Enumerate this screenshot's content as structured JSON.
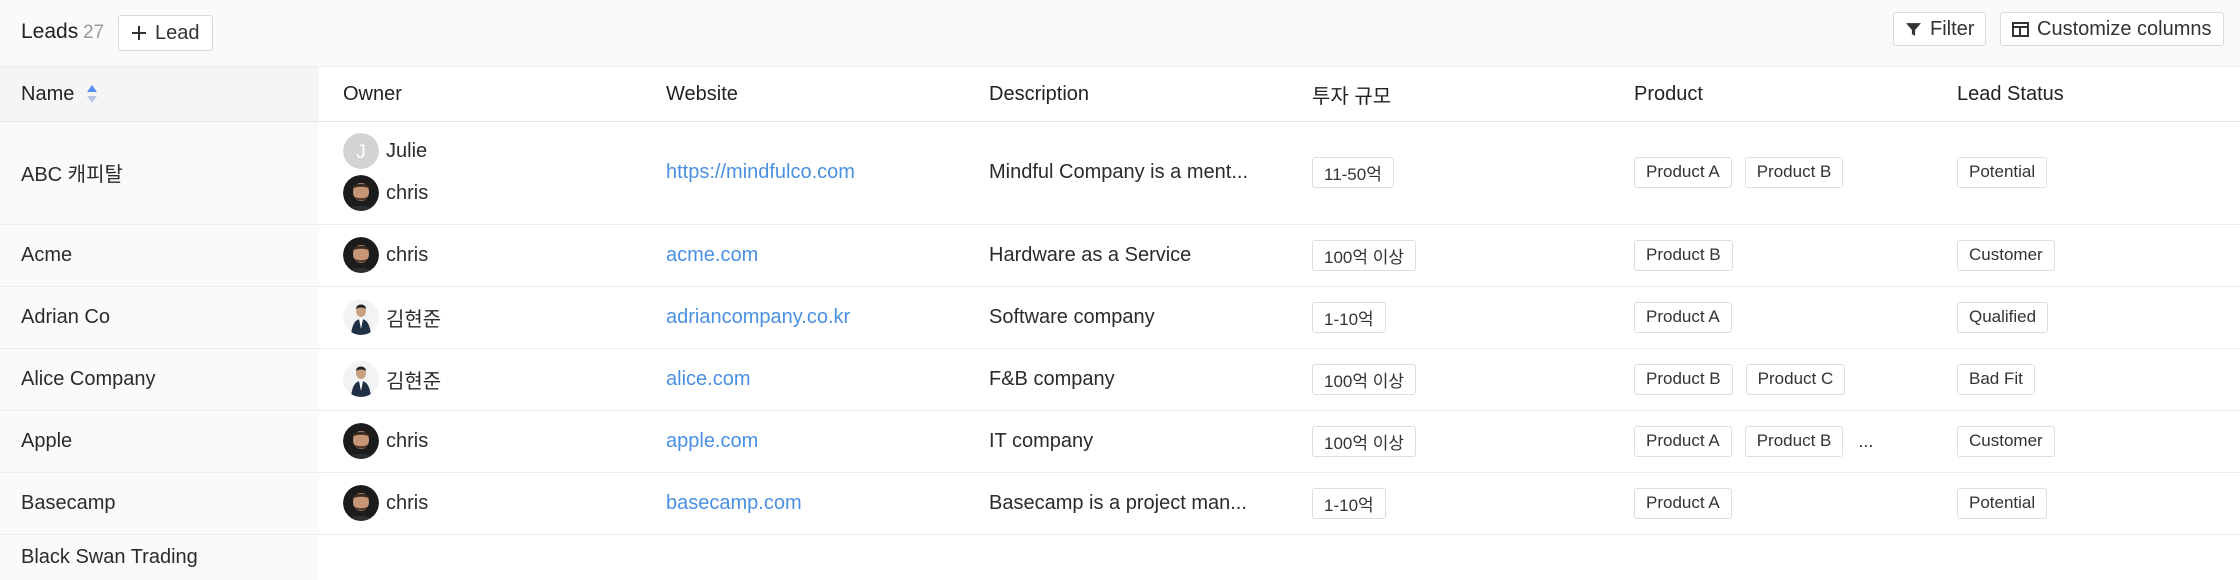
{
  "toolbar": {
    "title": "Leads",
    "count": "27",
    "add_label": "Lead",
    "filter_label": "Filter",
    "customize_label": "Customize columns"
  },
  "columns": [
    "Name",
    "Owner",
    "Website",
    "Description",
    "투자 규모",
    "Product",
    "Lead Status"
  ],
  "rows": [
    {
      "name": "ABC 캐피탈",
      "owners": [
        {
          "name": "Julie",
          "avatar": "initial",
          "initial": "J"
        },
        {
          "name": "chris",
          "avatar": "photo-dark"
        }
      ],
      "website": "https://mindfulco.com",
      "description": "Mindful Company is a ment...",
      "investment": "11-50억",
      "products": [
        "Product A",
        "Product B"
      ],
      "more": "",
      "status": "Potential"
    },
    {
      "name": "Acme",
      "owners": [
        {
          "name": "chris",
          "avatar": "photo-dark"
        }
      ],
      "website": "acme.com",
      "description": "Hardware as a Service",
      "investment": "100억 이상",
      "products": [
        "Product B"
      ],
      "more": "",
      "status": "Customer"
    },
    {
      "name": "Adrian Co",
      "owners": [
        {
          "name": "김현준",
          "avatar": "photo-suit"
        }
      ],
      "website": "adriancompany.co.kr",
      "description": "Software company",
      "investment": "1-10억",
      "products": [
        "Product A"
      ],
      "more": "",
      "status": "Qualified"
    },
    {
      "name": "Alice Company",
      "owners": [
        {
          "name": "김현준",
          "avatar": "photo-suit"
        }
      ],
      "website": "alice.com",
      "description": "F&B company",
      "investment": "100억 이상",
      "products": [
        "Product B",
        "Product C"
      ],
      "more": "",
      "status": "Bad Fit"
    },
    {
      "name": "Apple",
      "owners": [
        {
          "name": "chris",
          "avatar": "photo-dark"
        }
      ],
      "website": "apple.com",
      "description": "IT company",
      "investment": "100억 이상",
      "products": [
        "Product A",
        "Product B"
      ],
      "more": "...",
      "status": "Customer"
    },
    {
      "name": "Basecamp",
      "owners": [
        {
          "name": "chris",
          "avatar": "photo-dark"
        }
      ],
      "website": "basecamp.com",
      "description": "Basecamp is a project man...",
      "investment": "1-10억",
      "products": [
        "Product A"
      ],
      "more": "",
      "status": "Potential"
    },
    {
      "name": "Black Swan Trading",
      "owners": [],
      "website": "",
      "description": "",
      "investment": "",
      "products": [],
      "more": "",
      "status": ""
    }
  ],
  "icons": {
    "add": "plus-icon",
    "filter": "filter-icon",
    "customize": "columns-icon",
    "sort": "sort-icon"
  },
  "colors": {
    "link": "#4a90e2",
    "sort_active": "#5b8ff0",
    "sort_inactive": "#b9c6e6"
  }
}
